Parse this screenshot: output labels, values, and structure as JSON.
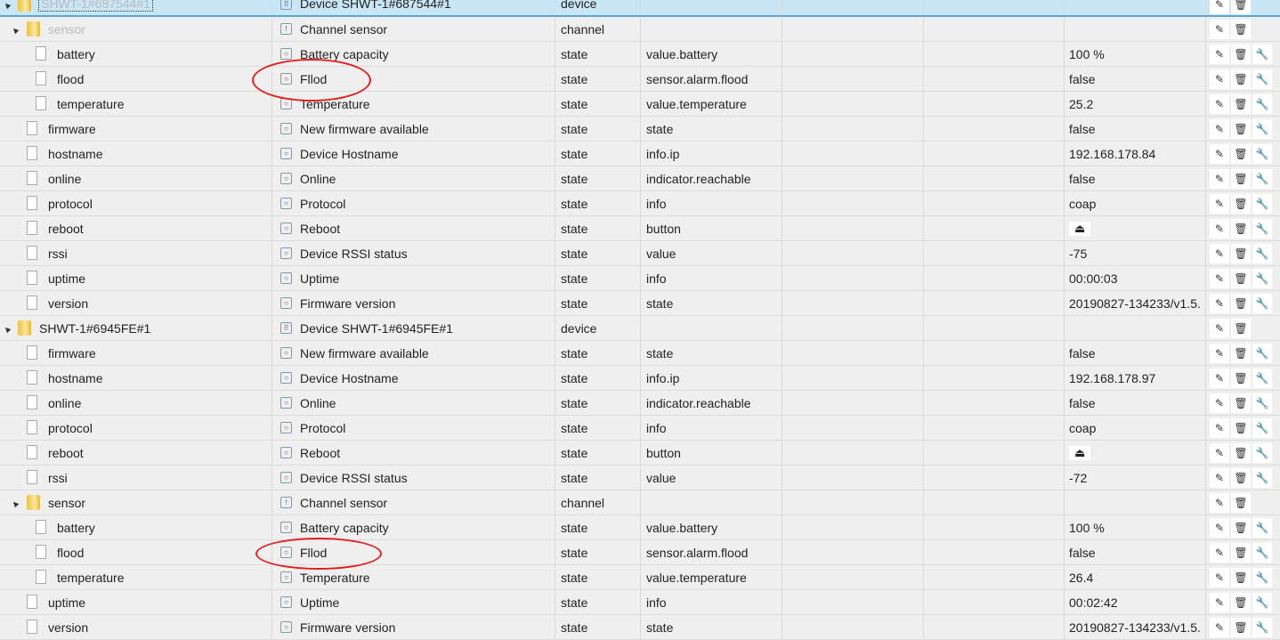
{
  "rows": [
    {
      "id": "SHWT-1#687544#1",
      "level": 0,
      "kind": "folder",
      "toggle": true,
      "sel": true,
      "icon": "device",
      "name": "Device SHWT-1#687544#1",
      "type": "device",
      "role": "",
      "value": "",
      "wrench": false
    },
    {
      "id": "sensor",
      "level": 1,
      "kind": "folder",
      "toggle": true,
      "muted": true,
      "icon": "channel",
      "name": "Channel sensor",
      "type": "channel",
      "role": "",
      "value": "",
      "wrench": false
    },
    {
      "id": "battery",
      "level": 2,
      "kind": "file",
      "icon": "state",
      "name": "Battery capacity",
      "type": "state",
      "role": "value.battery",
      "value": "100 %",
      "wrench": true
    },
    {
      "id": "flood",
      "level": 2,
      "kind": "file",
      "icon": "state",
      "name": "Fllod",
      "type": "state",
      "role": "sensor.alarm.flood",
      "value": "false",
      "wrench": true
    },
    {
      "id": "temperature",
      "level": 2,
      "kind": "file",
      "icon": "state",
      "name": "Temperature",
      "type": "state",
      "role": "value.temperature",
      "value": "25.2",
      "wrench": true
    },
    {
      "id": "firmware",
      "level": 1,
      "kind": "file",
      "icon": "state",
      "name": "New firmware available",
      "type": "state",
      "role": "state",
      "value": "false",
      "wrench": true
    },
    {
      "id": "hostname",
      "level": 1,
      "kind": "file",
      "icon": "state",
      "name": "Device Hostname",
      "type": "state",
      "role": "info.ip",
      "value": "192.168.178.84",
      "wrench": true
    },
    {
      "id": "online",
      "level": 1,
      "kind": "file",
      "icon": "state",
      "name": "Online",
      "type": "state",
      "role": "indicator.reachable",
      "value": "false",
      "wrench": true
    },
    {
      "id": "protocol",
      "level": 1,
      "kind": "file",
      "icon": "state",
      "name": "Protocol",
      "type": "state",
      "role": "info",
      "value": "coap",
      "wrench": true
    },
    {
      "id": "reboot",
      "level": 1,
      "kind": "file",
      "icon": "state",
      "name": "Reboot",
      "type": "state",
      "role": "button",
      "value": "⏏",
      "eject": true,
      "wrench": true
    },
    {
      "id": "rssi",
      "level": 1,
      "kind": "file",
      "icon": "state",
      "name": "Device RSSI status",
      "type": "state",
      "role": "value",
      "value": "-75",
      "wrench": true
    },
    {
      "id": "uptime",
      "level": 1,
      "kind": "file",
      "icon": "state",
      "name": "Uptime",
      "type": "state",
      "role": "info",
      "value": "00:00:03",
      "wrench": true
    },
    {
      "id": "version",
      "level": 1,
      "kind": "file",
      "icon": "state",
      "name": "Firmware version",
      "type": "state",
      "role": "state",
      "value": "20190827-134233/v1.5.",
      "wrench": true
    },
    {
      "id": "SHWT-1#6945FE#1",
      "level": 0,
      "kind": "folder",
      "toggle": true,
      "icon": "device",
      "name": "Device SHWT-1#6945FE#1",
      "type": "device",
      "role": "",
      "value": "",
      "wrench": false
    },
    {
      "id": "firmware",
      "level": 1,
      "kind": "file",
      "icon": "state",
      "name": "New firmware available",
      "type": "state",
      "role": "state",
      "value": "false",
      "wrench": true
    },
    {
      "id": "hostname",
      "level": 1,
      "kind": "file",
      "icon": "state",
      "name": "Device Hostname",
      "type": "state",
      "role": "info.ip",
      "value": "192.168.178.97",
      "wrench": true
    },
    {
      "id": "online",
      "level": 1,
      "kind": "file",
      "icon": "state",
      "name": "Online",
      "type": "state",
      "role": "indicator.reachable",
      "value": "false",
      "wrench": true
    },
    {
      "id": "protocol",
      "level": 1,
      "kind": "file",
      "icon": "state",
      "name": "Protocol",
      "type": "state",
      "role": "info",
      "value": "coap",
      "wrench": true
    },
    {
      "id": "reboot",
      "level": 1,
      "kind": "file",
      "icon": "state",
      "name": "Reboot",
      "type": "state",
      "role": "button",
      "value": "⏏",
      "eject": true,
      "wrench": true
    },
    {
      "id": "rssi",
      "level": 1,
      "kind": "file",
      "icon": "state",
      "name": "Device RSSI status",
      "type": "state",
      "role": "value",
      "value": "-72",
      "wrench": true
    },
    {
      "id": "sensor",
      "level": 1,
      "kind": "folder",
      "toggle": true,
      "icon": "channel",
      "name": "Channel sensor",
      "type": "channel",
      "role": "",
      "value": "",
      "wrench": false
    },
    {
      "id": "battery",
      "level": 2,
      "kind": "file",
      "icon": "state",
      "name": "Battery capacity",
      "type": "state",
      "role": "value.battery",
      "value": "100 %",
      "wrench": true
    },
    {
      "id": "flood",
      "level": 2,
      "kind": "file",
      "icon": "state",
      "name": "Fllod",
      "type": "state",
      "role": "sensor.alarm.flood",
      "value": "false",
      "wrench": true
    },
    {
      "id": "temperature",
      "level": 2,
      "kind": "file",
      "icon": "state",
      "name": "Temperature",
      "type": "state",
      "role": "value.temperature",
      "value": "26.4",
      "wrench": true
    },
    {
      "id": "uptime",
      "level": 1,
      "kind": "file",
      "icon": "state",
      "name": "Uptime",
      "type": "state",
      "role": "info",
      "value": "00:02:42",
      "wrench": true
    },
    {
      "id": "version",
      "level": 1,
      "kind": "file",
      "icon": "state",
      "name": "Firmware version",
      "type": "state",
      "role": "state",
      "value": "20190827-134233/v1.5.",
      "wrench": true
    }
  ],
  "annotation_color": "#e02020"
}
